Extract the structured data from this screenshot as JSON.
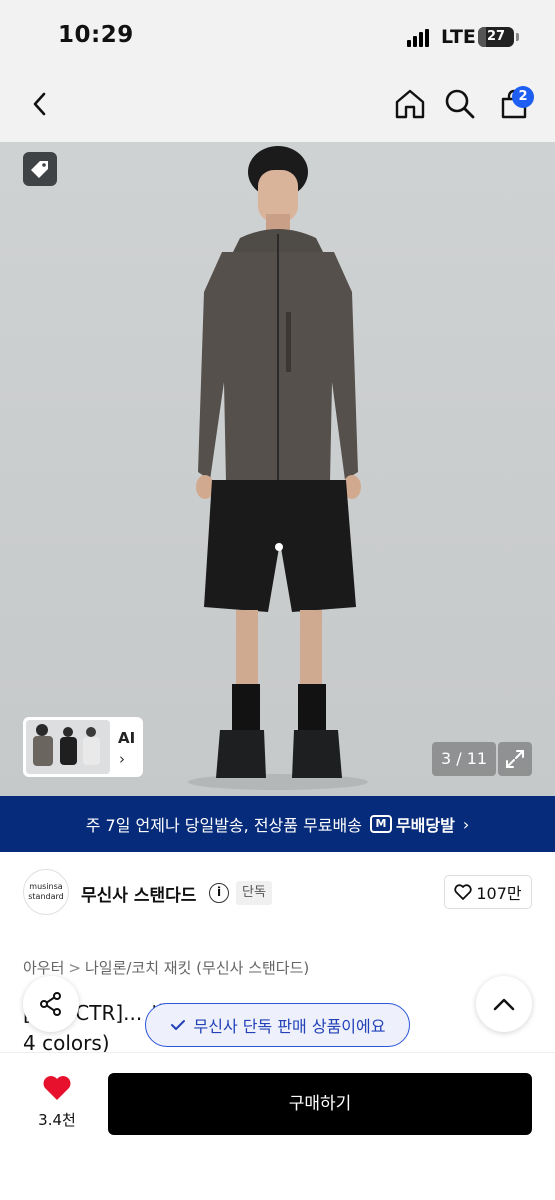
{
  "status_bar": {
    "time": "10:29",
    "network": "LTE",
    "battery": "27"
  },
  "header": {
    "cart_count": "2"
  },
  "gallery": {
    "current": "3",
    "total": "11",
    "ai_label": "AI",
    "ai_chevron": "›",
    "counter_separator": " / "
  },
  "banner": {
    "text": "주 7일 언제나 당일발송, 전상품 무료배송",
    "logo_mark": "M",
    "logo_text": "무배당발",
    "chevron": "›"
  },
  "brand": {
    "logo_line1": "musinsa",
    "logo_line2": "standard",
    "name": "무신사 스탠다드",
    "info_glyph": "i",
    "exclusive_badge": "단독",
    "likes": "107만"
  },
  "breadcrumb": {
    "items": [
      "아우터",
      "나일론/코치 재킷 (무신사 스탠다드)"
    ],
    "separator": ">"
  },
  "product": {
    "title_line1": "[... n CTR]... 세탁 윈드브레이커 재...",
    "title_line2": "4 colors)"
  },
  "toast": {
    "text": "무신사 단독 판매 상품이에요"
  },
  "bottom": {
    "wish_count": "3.4천",
    "buy_label": "구매하기"
  },
  "colors": {
    "accent": "#1f5ef2",
    "banner_bg": "#062b7b",
    "wish_heart": "#e8112d",
    "toast_border": "#2c56d8"
  }
}
